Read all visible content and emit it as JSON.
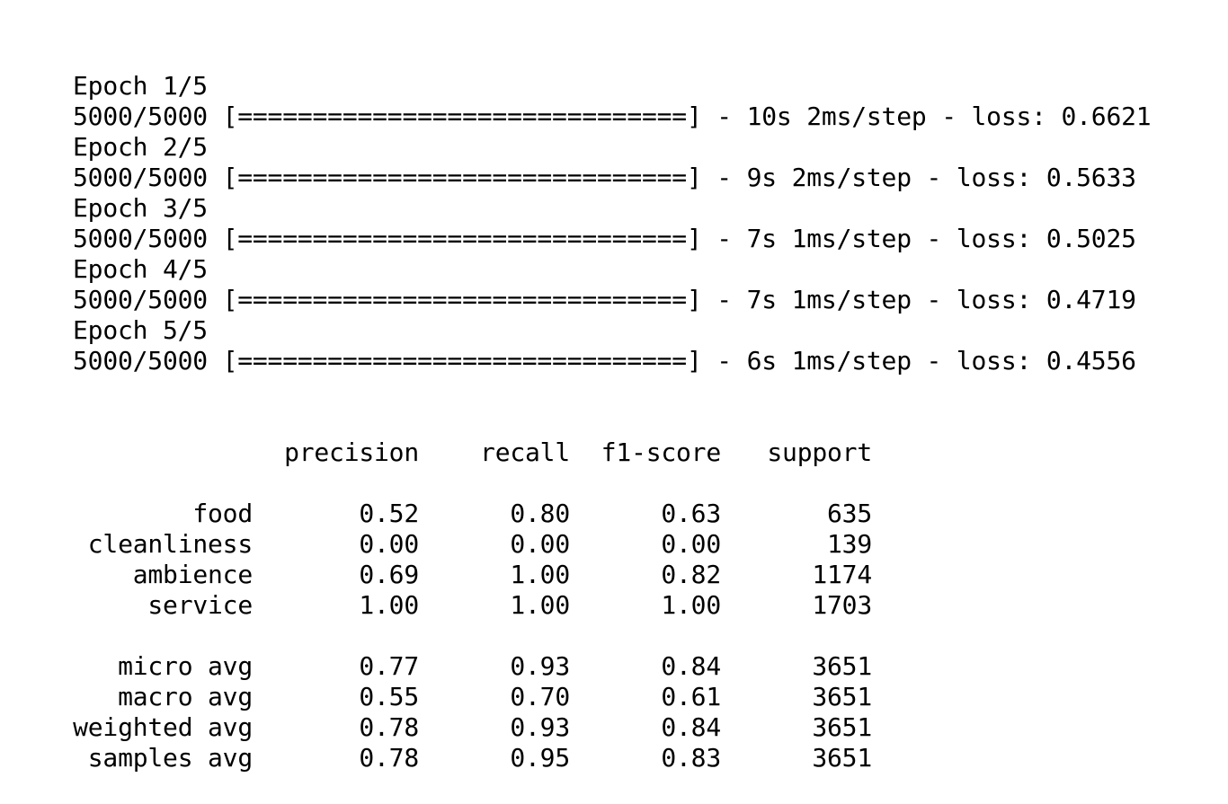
{
  "training_log": [
    {
      "epoch": "Epoch 1/5",
      "progress": "5000/5000 [==============================]",
      "time": "10s",
      "per_step": "2ms/step",
      "loss": "0.6621"
    },
    {
      "epoch": "Epoch 2/5",
      "progress": "5000/5000 [==============================]",
      "time": "9s",
      "per_step": "2ms/step",
      "loss": "0.5633"
    },
    {
      "epoch": "Epoch 3/5",
      "progress": "5000/5000 [==============================]",
      "time": "7s",
      "per_step": "1ms/step",
      "loss": "0.5025"
    },
    {
      "epoch": "Epoch 4/5",
      "progress": "5000/5000 [==============================]",
      "time": "7s",
      "per_step": "1ms/step",
      "loss": "0.4719"
    },
    {
      "epoch": "Epoch 5/5",
      "progress": "5000/5000 [==============================]",
      "time": "6s",
      "per_step": "1ms/step",
      "loss": "0.4556"
    }
  ],
  "log_separator": " - ",
  "loss_label": "loss: ",
  "report": {
    "headers": [
      "precision",
      "recall",
      "f1-score",
      "support"
    ],
    "class_rows": [
      {
        "label": "food",
        "values": [
          "0.52",
          "0.80",
          "0.63",
          "635"
        ]
      },
      {
        "label": "cleanliness",
        "values": [
          "0.00",
          "0.00",
          "0.00",
          "139"
        ]
      },
      {
        "label": "ambience",
        "values": [
          "0.69",
          "1.00",
          "0.82",
          "1174"
        ]
      },
      {
        "label": "service",
        "values": [
          "1.00",
          "1.00",
          "1.00",
          "1703"
        ]
      }
    ],
    "avg_rows": [
      {
        "label": "micro avg",
        "values": [
          "0.77",
          "0.93",
          "0.84",
          "3651"
        ]
      },
      {
        "label": "macro avg",
        "values": [
          "0.55",
          "0.70",
          "0.61",
          "3651"
        ]
      },
      {
        "label": "weighted avg",
        "values": [
          "0.78",
          "0.93",
          "0.84",
          "3651"
        ]
      },
      {
        "label": "samples avg",
        "values": [
          "0.78",
          "0.95",
          "0.83",
          "3651"
        ]
      }
    ]
  }
}
